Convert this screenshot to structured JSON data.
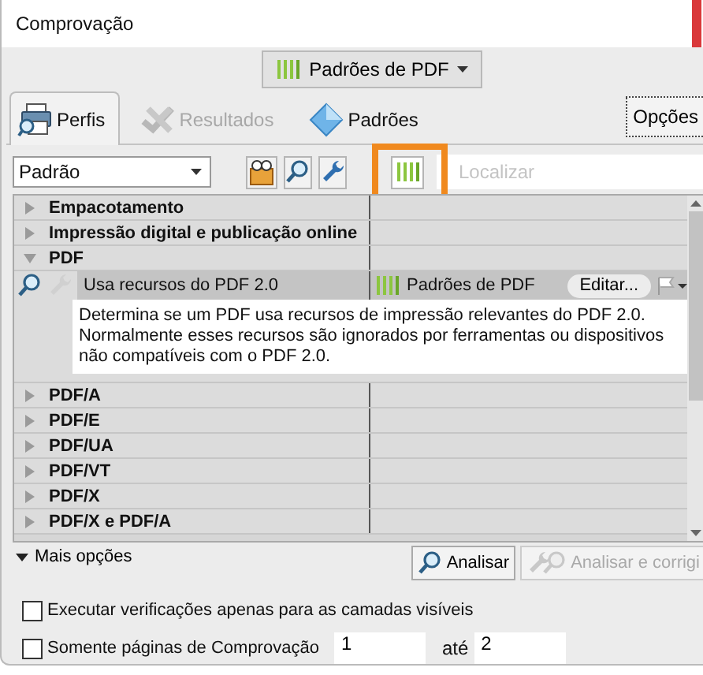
{
  "window": {
    "title": "Comprovação"
  },
  "library_button": {
    "label": "Padrões de PDF"
  },
  "tabs": [
    {
      "label": "Perfis",
      "selected": true,
      "disabled": false
    },
    {
      "label": "Resultados",
      "selected": false,
      "disabled": true
    },
    {
      "label": "Padrões",
      "selected": false,
      "disabled": false
    }
  ],
  "options_button": {
    "label": "Opções"
  },
  "profile_select": {
    "value": "Padrão"
  },
  "filter_button": {
    "highlighted": true
  },
  "search": {
    "placeholder": "Localizar"
  },
  "tree": [
    {
      "label": "Empacotamento",
      "expanded": false
    },
    {
      "label": "Impressão digital e publicação online",
      "expanded": false
    },
    {
      "label": "PDF",
      "expanded": true,
      "children": [
        {
          "label": "Usa recursos do PDF 2.0",
          "selected": true,
          "library": "Padrões de PDF",
          "action": "Editar...",
          "description": "Determina se um PDF usa recursos de impressão relevantes do PDF 2.0. Normalmente esses recursos são ignorados por ferramentas ou dispositivos não compatíveis com o PDF 2.0."
        }
      ]
    },
    {
      "label": "PDF/A",
      "expanded": false
    },
    {
      "label": "PDF/E",
      "expanded": false
    },
    {
      "label": "PDF/UA",
      "expanded": false
    },
    {
      "label": "PDF/VT",
      "expanded": false
    },
    {
      "label": "PDF/X",
      "expanded": false
    },
    {
      "label": "PDF/X e PDF/A",
      "expanded": false
    }
  ],
  "more_options": {
    "label": "Mais opções",
    "expanded": true
  },
  "actions": [
    {
      "label": "Analisar",
      "disabled": false
    },
    {
      "label": "Analisar e corrigi",
      "disabled": true
    }
  ],
  "checkboxes": [
    {
      "label": "Executar verificações apenas para as camadas visíveis",
      "checked": false
    },
    {
      "label": "Somente páginas de Comprovação",
      "checked": false
    }
  ],
  "page_range": {
    "from": "1",
    "to_label": "até",
    "to": "2"
  }
}
